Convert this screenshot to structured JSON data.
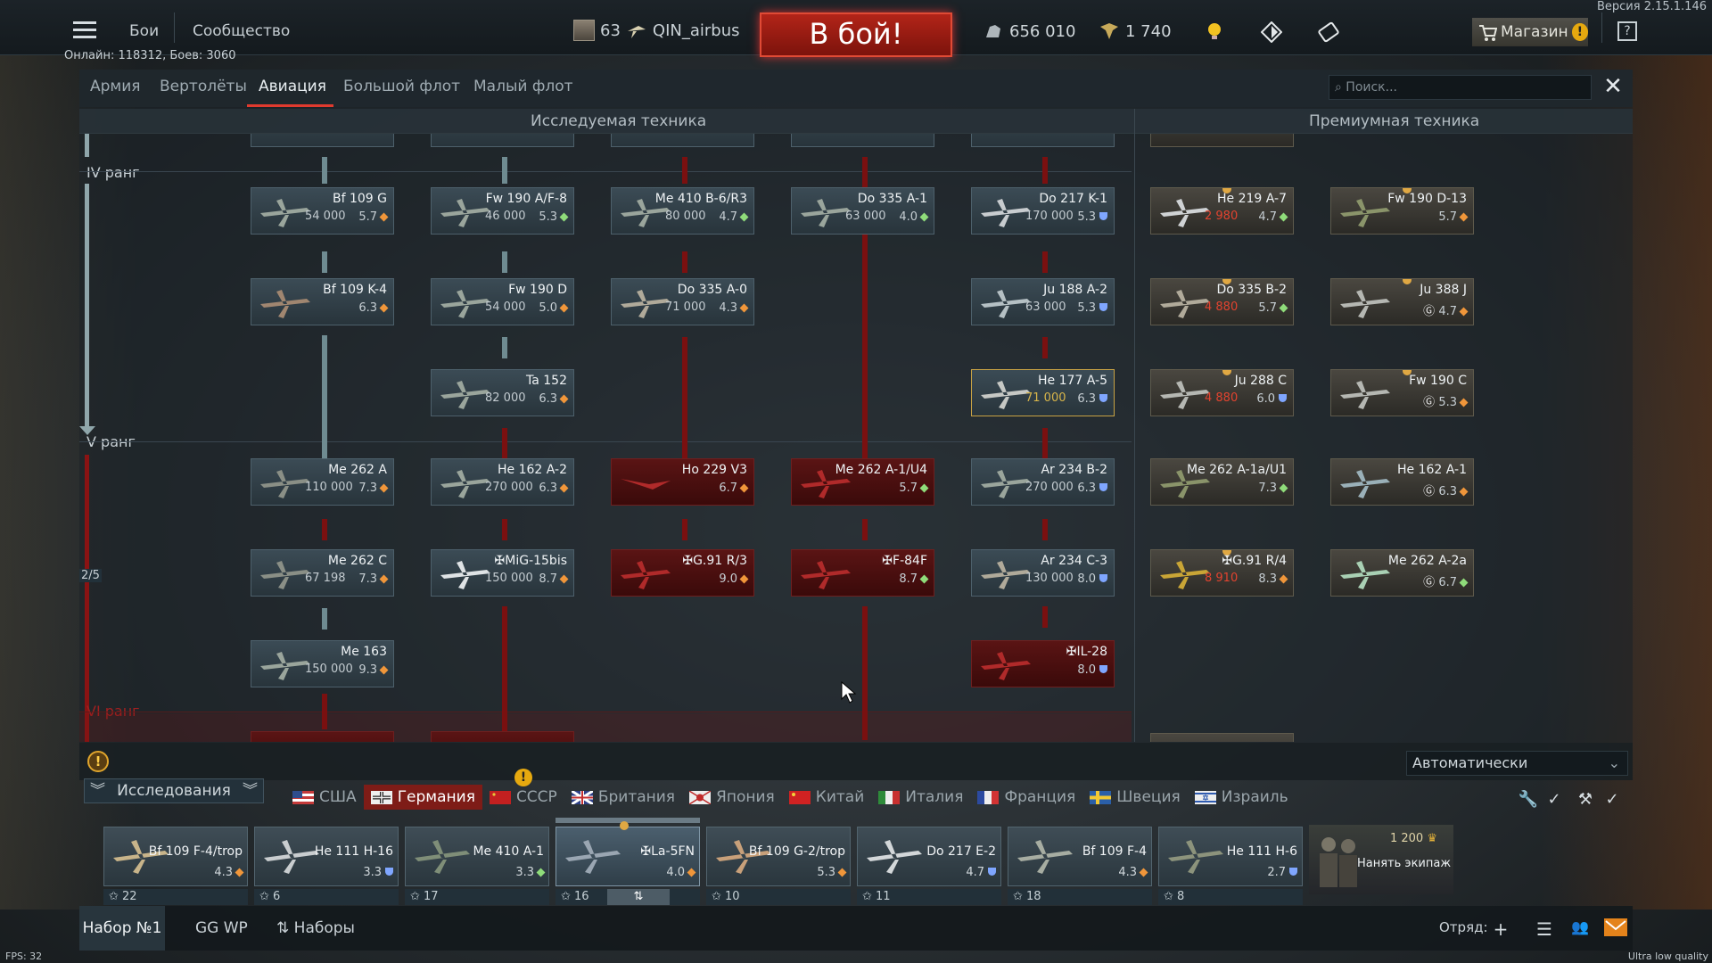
{
  "version": "Версия 2.15.1.146",
  "topnav": {
    "battles": "Бои",
    "community": "Сообщество"
  },
  "online": "Онлайн: 118312, Боев: 3060",
  "player": {
    "level": "63",
    "name": "QIN_airbus"
  },
  "battle_button": "В бой!",
  "resources": {
    "silver_lions": "656 010",
    "research_points": "1 740"
  },
  "shop": {
    "label": "Магазин"
  },
  "help": "?",
  "tabs": [
    "Армия",
    "Вертолёты",
    "Авиация",
    "Большой флот",
    "Малый флот"
  ],
  "active_tab": "Авиация",
  "search": {
    "placeholder": "Поиск..."
  },
  "sections": {
    "researched": "Исследуемая техника",
    "premium": "Премиумная техника"
  },
  "ranks": {
    "r4": "IV ранг",
    "r5": "V ранг",
    "r6": "VI ранг",
    "progress": "2/5"
  },
  "tree_cards": [
    {
      "name": "Bf 109 G",
      "cost": "54 000",
      "br": "5.7"
    },
    {
      "name": "Fw 190 A/F-8",
      "cost": "46 000",
      "br": "5.3"
    },
    {
      "name": "Me 410 B-6/R3",
      "cost": "80 000",
      "br": "4.7"
    },
    {
      "name": "Do 335 A-1",
      "cost": "63 000",
      "br": "4.0"
    },
    {
      "name": "Do 217 K-1",
      "cost": "170 000",
      "br": "5.3"
    },
    {
      "name": "He 219 A-7",
      "cost": "2 980",
      "br": "4.7"
    },
    {
      "name": "Fw 190 D-13",
      "cost": "",
      "br": "5.7"
    },
    {
      "name": "Bf 109 K-4",
      "cost": "",
      "br": "6.3"
    },
    {
      "name": "Fw 190 D",
      "cost": "54 000",
      "br": "5.0"
    },
    {
      "name": "Do 335 A-0",
      "cost": "71 000",
      "br": "4.3"
    },
    {
      "name": "Ju 188 A-2",
      "cost": "63 000",
      "br": "5.3"
    },
    {
      "name": "Do 335 B-2",
      "cost": "4 880",
      "br": "5.7"
    },
    {
      "name": "Ju 388 J",
      "cost": "",
      "br": "4.7"
    },
    {
      "name": "Ta 152",
      "cost": "82 000",
      "br": "6.3"
    },
    {
      "name": "He 177 A-5",
      "cost": "71 000",
      "br": "6.3"
    },
    {
      "name": "Ju 288 C",
      "cost": "4 880",
      "br": "6.0"
    },
    {
      "name": "Fw 190 C",
      "cost": "",
      "br": "5.3"
    },
    {
      "name": "Me 262 A",
      "cost": "110 000",
      "br": "7.3"
    },
    {
      "name": "He 162 A-2",
      "cost": "270 000",
      "br": "6.3"
    },
    {
      "name": "Ho 229 V3",
      "cost": "",
      "br": "6.7"
    },
    {
      "name": "Me 262 A-1/U4",
      "cost": "",
      "br": "5.7"
    },
    {
      "name": "Ar 234 B-2",
      "cost": "270 000",
      "br": "6.3"
    },
    {
      "name": "Me 262 A-1a/U1",
      "cost": "",
      "br": "7.3"
    },
    {
      "name": "He 162 A-1",
      "cost": "",
      "br": "6.3"
    },
    {
      "name": "Me 262 C",
      "cost": "67 198",
      "br": "7.3"
    },
    {
      "name": "✠MiG-15bis",
      "cost": "150 000",
      "br": "8.7"
    },
    {
      "name": "✠G.91 R/3",
      "cost": "",
      "br": "9.0"
    },
    {
      "name": "✠F-84F",
      "cost": "",
      "br": "8.7"
    },
    {
      "name": "Ar 234 C-3",
      "cost": "130 000",
      "br": "8.0"
    },
    {
      "name": "✠G.91 R/4",
      "cost": "8 910",
      "br": "8.3"
    },
    {
      "name": "Me 262 A-2a",
      "cost": "",
      "br": "6.7"
    },
    {
      "name": "Me 163",
      "cost": "150 000",
      "br": "9.3"
    },
    {
      "name": "✠IL-28",
      "cost": "",
      "br": "8.0"
    }
  ],
  "auto_select": "Автоматически",
  "research_button": "Исследования",
  "nations": [
    "США",
    "Германия",
    "СССР",
    "Британия",
    "Япония",
    "Китай",
    "Италия",
    "Франция",
    "Швеция",
    "Израиль"
  ],
  "active_nation": "Германия",
  "crew_slots": [
    {
      "name": "Bf 109 F-4/trop",
      "br": "4.3",
      "num": "22"
    },
    {
      "name": "He 111 H-16",
      "br": "3.3",
      "num": "6"
    },
    {
      "name": "Me 410 A-1",
      "br": "3.3",
      "num": "17"
    },
    {
      "name": "✠La-5FN",
      "br": "4.0",
      "num": "16"
    },
    {
      "name": "Bf 109 G-2/trop",
      "br": "5.3",
      "num": "10"
    },
    {
      "name": "Do 217 E-2",
      "br": "4.7",
      "num": "11"
    },
    {
      "name": "Bf 109 F-4",
      "br": "4.3",
      "num": "18"
    },
    {
      "name": "He 111 H-6",
      "br": "2.7",
      "num": "8"
    }
  ],
  "hire": {
    "cost": "1 200",
    "label": "Нанять экипаж"
  },
  "bottom": {
    "preset": "Набор №1",
    "ggwp": "GG WP",
    "presets": "Наборы",
    "squad": "Отряд:"
  },
  "fps": "FPS: 32",
  "quality": "Ultra low quality",
  "colors": {
    "accent_red": "#e03a2e",
    "battle_button": "#b22418",
    "nation_active": "#7e1c17",
    "research_cost_red": "#e2432f",
    "premium_gold": "#e0a843"
  }
}
